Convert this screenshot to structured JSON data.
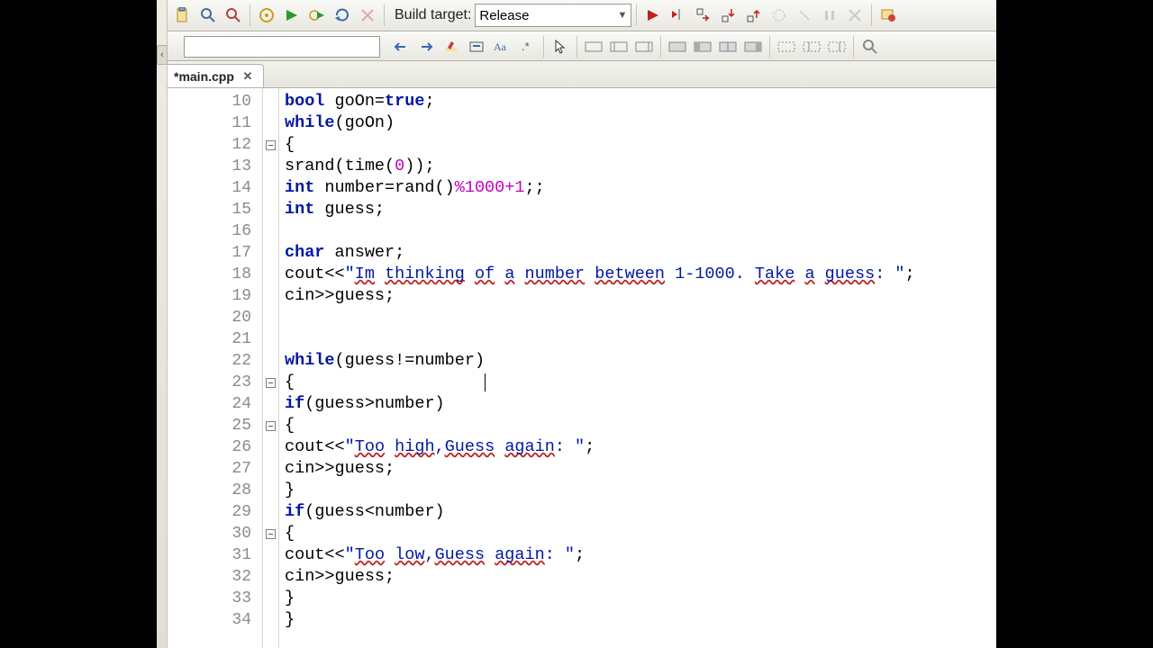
{
  "toolbar": {
    "build_target_label": "Build target:",
    "build_target_value": "Release"
  },
  "search_value": "",
  "tab": {
    "name": "*main.cpp"
  },
  "chart_data": null,
  "code": {
    "first_line": 10,
    "fold_lines": [
      12,
      23,
      25,
      30
    ],
    "caret": {
      "line": 23,
      "col": 20
    },
    "lines": [
      {
        "n": 10,
        "tokens": [
          {
            "t": "kw",
            "s": "bool"
          },
          {
            "t": "",
            "s": " goOn="
          },
          {
            "t": "kw",
            "s": "true"
          },
          {
            "t": "",
            "s": ";"
          }
        ]
      },
      {
        "n": 11,
        "tokens": [
          {
            "t": "kw",
            "s": "while"
          },
          {
            "t": "",
            "s": "(goOn)"
          }
        ]
      },
      {
        "n": 12,
        "tokens": [
          {
            "t": "",
            "s": "{"
          }
        ]
      },
      {
        "n": 13,
        "tokens": [
          {
            "t": "",
            "s": "srand(time("
          },
          {
            "t": "num",
            "s": "0"
          },
          {
            "t": "",
            "s": "));"
          }
        ]
      },
      {
        "n": 14,
        "tokens": [
          {
            "t": "kw",
            "s": "int"
          },
          {
            "t": "",
            "s": " number=rand()"
          },
          {
            "t": "num",
            "s": "%1000+1"
          },
          {
            "t": "",
            "s": ";;"
          }
        ]
      },
      {
        "n": 15,
        "tokens": [
          {
            "t": "kw",
            "s": "int"
          },
          {
            "t": "",
            "s": " guess;"
          }
        ]
      },
      {
        "n": 16,
        "tokens": []
      },
      {
        "n": 17,
        "tokens": [
          {
            "t": "kw",
            "s": "char"
          },
          {
            "t": "",
            "s": " answer;"
          }
        ]
      },
      {
        "n": 18,
        "tokens": [
          {
            "t": "",
            "s": "cout<<"
          },
          {
            "t": "str",
            "s": "\""
          },
          {
            "t": "spell str",
            "s": "Im"
          },
          {
            "t": "str",
            "s": " "
          },
          {
            "t": "spell str",
            "s": "thinking"
          },
          {
            "t": "str",
            "s": " "
          },
          {
            "t": "spell str",
            "s": "of"
          },
          {
            "t": "str",
            "s": " "
          },
          {
            "t": "spell str",
            "s": "a"
          },
          {
            "t": "str",
            "s": " "
          },
          {
            "t": "spell str",
            "s": "number"
          },
          {
            "t": "str",
            "s": " "
          },
          {
            "t": "spell str",
            "s": "between"
          },
          {
            "t": "str",
            "s": " 1-1000. "
          },
          {
            "t": "spell str",
            "s": "Take"
          },
          {
            "t": "str",
            "s": " "
          },
          {
            "t": "spell str",
            "s": "a"
          },
          {
            "t": "str",
            "s": " "
          },
          {
            "t": "spell str",
            "s": "guess"
          },
          {
            "t": "str",
            "s": ": \""
          },
          {
            "t": "",
            "s": ";"
          }
        ]
      },
      {
        "n": 19,
        "tokens": [
          {
            "t": "",
            "s": "cin>>guess;"
          }
        ]
      },
      {
        "n": 20,
        "tokens": []
      },
      {
        "n": 21,
        "tokens": []
      },
      {
        "n": 22,
        "tokens": [
          {
            "t": "kw",
            "s": "while"
          },
          {
            "t": "",
            "s": "(guess!=number)"
          }
        ]
      },
      {
        "n": 23,
        "tokens": [
          {
            "t": "",
            "s": "{"
          }
        ]
      },
      {
        "n": 24,
        "tokens": [
          {
            "t": "kw",
            "s": "if"
          },
          {
            "t": "",
            "s": "(guess>number)"
          }
        ]
      },
      {
        "n": 25,
        "tokens": [
          {
            "t": "",
            "s": "{"
          }
        ]
      },
      {
        "n": 26,
        "tokens": [
          {
            "t": "",
            "s": "cout<<"
          },
          {
            "t": "str",
            "s": "\""
          },
          {
            "t": "spell str",
            "s": "Too"
          },
          {
            "t": "str",
            "s": " "
          },
          {
            "t": "spell str",
            "s": "high"
          },
          {
            "t": "str",
            "s": ","
          },
          {
            "t": "spell str",
            "s": "Guess"
          },
          {
            "t": "str",
            "s": " "
          },
          {
            "t": "spell str",
            "s": "again"
          },
          {
            "t": "str",
            "s": ": \""
          },
          {
            "t": "",
            "s": ";"
          }
        ]
      },
      {
        "n": 27,
        "tokens": [
          {
            "t": "",
            "s": "cin>>guess;"
          }
        ]
      },
      {
        "n": 28,
        "tokens": [
          {
            "t": "",
            "s": "}"
          }
        ]
      },
      {
        "n": 29,
        "tokens": [
          {
            "t": "kw",
            "s": "if"
          },
          {
            "t": "",
            "s": "(guess<number)"
          }
        ]
      },
      {
        "n": 30,
        "tokens": [
          {
            "t": "",
            "s": "{"
          }
        ]
      },
      {
        "n": 31,
        "tokens": [
          {
            "t": "",
            "s": "cout<<"
          },
          {
            "t": "str",
            "s": "\""
          },
          {
            "t": "spell str",
            "s": "Too"
          },
          {
            "t": "str",
            "s": " "
          },
          {
            "t": "spell str",
            "s": "low"
          },
          {
            "t": "str",
            "s": ","
          },
          {
            "t": "spell str",
            "s": "Guess"
          },
          {
            "t": "str",
            "s": " "
          },
          {
            "t": "spell str",
            "s": "again"
          },
          {
            "t": "str",
            "s": ": \""
          },
          {
            "t": "",
            "s": ";"
          }
        ]
      },
      {
        "n": 32,
        "tokens": [
          {
            "t": "",
            "s": "cin>>guess;"
          }
        ]
      },
      {
        "n": 33,
        "tokens": [
          {
            "t": "",
            "s": "}"
          }
        ]
      },
      {
        "n": 34,
        "tokens": [
          {
            "t": "",
            "s": "}"
          }
        ]
      }
    ]
  }
}
